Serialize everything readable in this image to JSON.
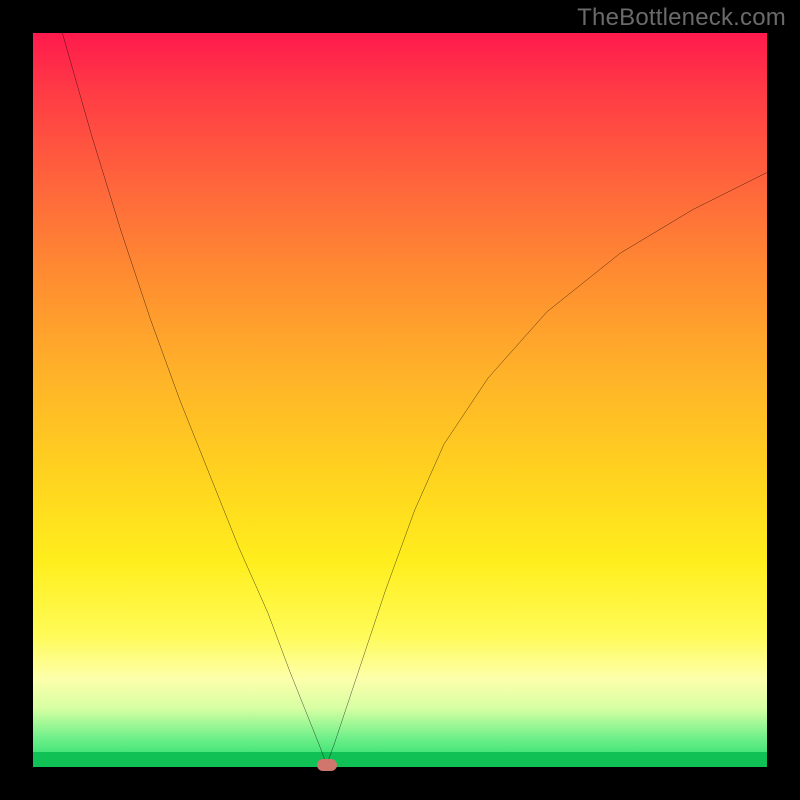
{
  "watermark": "TheBottleneck.com",
  "colors": {
    "frame": "#000000",
    "curve": "#000000",
    "marker": "#d1766d",
    "watermark": "#6a6a6a"
  },
  "chart_data": {
    "type": "line",
    "title": "",
    "xlabel": "",
    "ylabel": "",
    "xlim": [
      0,
      100
    ],
    "ylim": [
      0,
      100
    ],
    "grid": false,
    "legend": false,
    "series": [
      {
        "name": "bottleneck-curve",
        "x": [
          4,
          8,
          12,
          16,
          20,
          24,
          28,
          32,
          35,
          37,
          39,
          40,
          41,
          44,
          48,
          52,
          56,
          62,
          70,
          80,
          90,
          100
        ],
        "y": [
          100,
          86,
          73,
          61,
          50,
          40,
          30,
          21,
          13,
          8,
          3,
          0.3,
          3,
          12,
          24,
          35,
          44,
          53,
          62,
          70,
          76,
          81
        ]
      }
    ],
    "marker": {
      "x": 40,
      "y": 0.3
    },
    "gradient_stops": [
      {
        "pos": 0,
        "color": "#ff1a4d"
      },
      {
        "pos": 8,
        "color": "#ff3b45"
      },
      {
        "pos": 22,
        "color": "#ff6a3b"
      },
      {
        "pos": 34,
        "color": "#ff8f30"
      },
      {
        "pos": 46,
        "color": "#ffb129"
      },
      {
        "pos": 60,
        "color": "#ffd21f"
      },
      {
        "pos": 72,
        "color": "#ffee1d"
      },
      {
        "pos": 82,
        "color": "#fffb57"
      },
      {
        "pos": 88,
        "color": "#fdffab"
      },
      {
        "pos": 92,
        "color": "#d7ffa3"
      },
      {
        "pos": 96,
        "color": "#70f08a"
      },
      {
        "pos": 100,
        "color": "#1edb6a"
      }
    ]
  }
}
